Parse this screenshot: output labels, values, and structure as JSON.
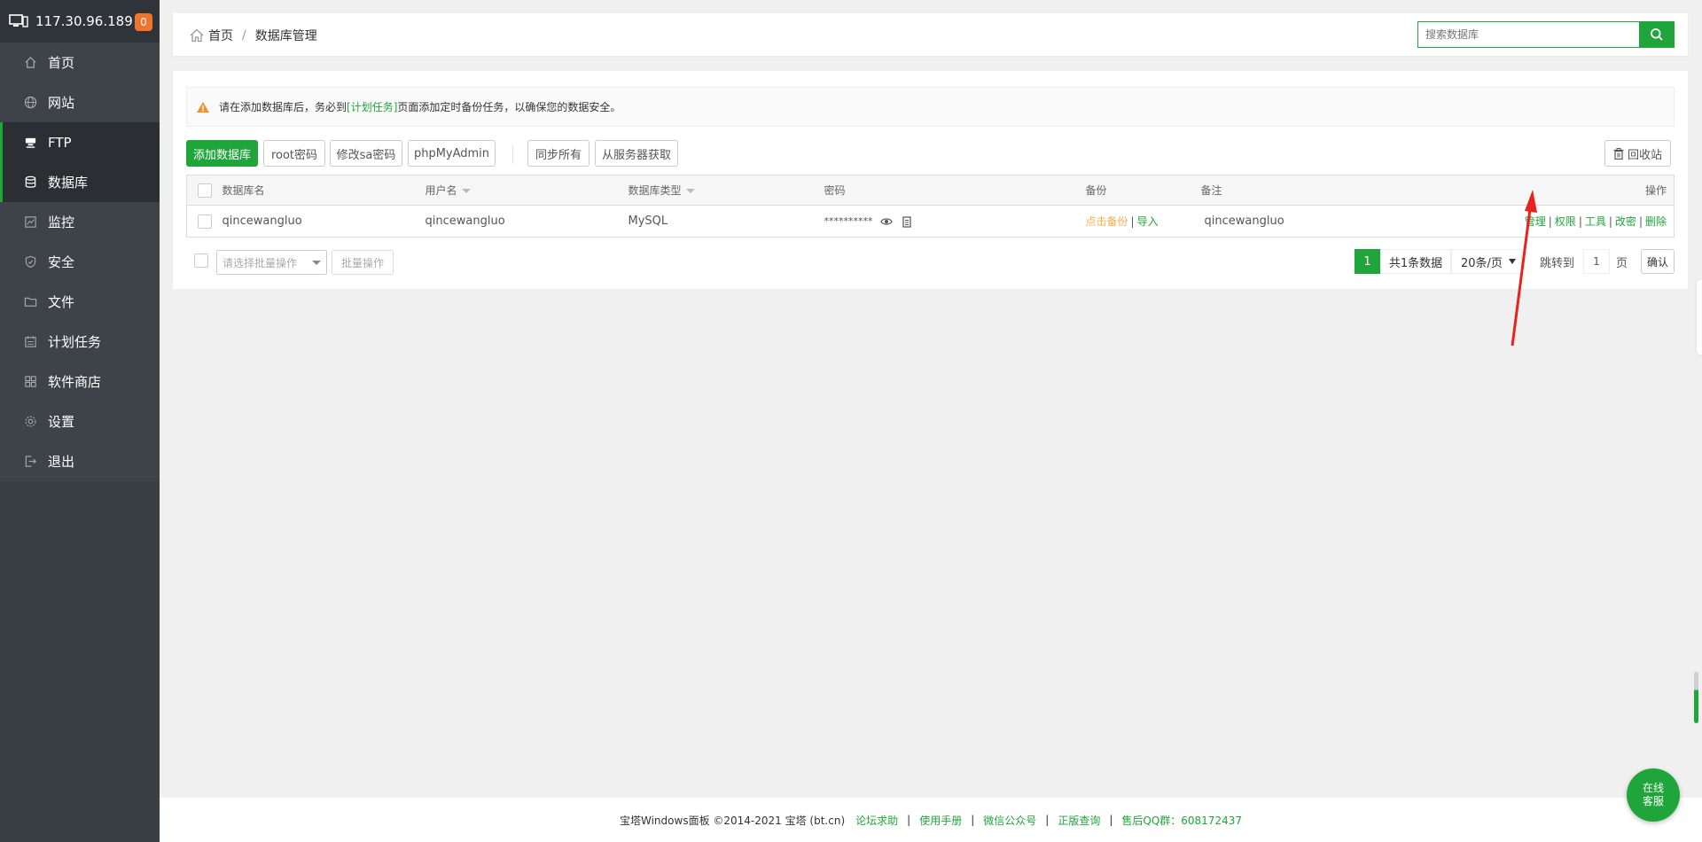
{
  "sidebar": {
    "ip": "117.30.96.189",
    "badge": "0",
    "items": [
      {
        "label": "首页",
        "icon": "home-icon"
      },
      {
        "label": "网站",
        "icon": "globe-icon"
      },
      {
        "label": "FTP",
        "icon": "ftp-icon"
      },
      {
        "label": "数据库",
        "icon": "database-icon"
      },
      {
        "label": "监控",
        "icon": "monitor-icon"
      },
      {
        "label": "安全",
        "icon": "shield-icon"
      },
      {
        "label": "文件",
        "icon": "folder-icon"
      },
      {
        "label": "计划任务",
        "icon": "calendar-icon"
      },
      {
        "label": "软件商店",
        "icon": "grid-icon"
      },
      {
        "label": "设置",
        "icon": "gear-icon"
      },
      {
        "label": "退出",
        "icon": "logout-icon"
      }
    ]
  },
  "breadcrumb": {
    "home": "首页",
    "current": "数据库管理"
  },
  "search": {
    "placeholder": "搜索数据库"
  },
  "notice": {
    "before": "请在添加数据库后，务必到",
    "link": "[计划任务]",
    "after": "页面添加定时备份任务，以确保您的数据安全。"
  },
  "toolbar": {
    "add_db": "添加数据库",
    "root_pwd": "root密码",
    "sa_pwd": "修改sa密码",
    "phpmyadmin": "phpMyAdmin",
    "sync_all": "同步所有",
    "from_server": "从服务器获取",
    "recycle": "回收站"
  },
  "table": {
    "headers": {
      "name": "数据库名",
      "user": "用户名",
      "type": "数据库类型",
      "password": "密码",
      "backup": "备份",
      "note": "备注",
      "ops": "操作"
    },
    "row": {
      "name": "qincewangluo",
      "user": "qincewangluo",
      "type": "MySQL",
      "password": "**********",
      "backup": "点击备份",
      "import": "导入",
      "note": "qincewangluo",
      "ops": [
        "管理",
        "权限",
        "工具",
        "改密",
        "删除"
      ]
    }
  },
  "batch": {
    "placeholder": "请选择批量操作",
    "button": "批量操作"
  },
  "pagination": {
    "current": "1",
    "total": "共1条数据",
    "page_size": "20条/页",
    "jump_label": "跳转到",
    "jump_value": "1",
    "page_unit": "页",
    "confirm": "确认"
  },
  "footer": {
    "copyright": "宝塔Windows面板 ©2014-2021 宝塔 (bt.cn)",
    "links": [
      "论坛求助",
      "使用手册",
      "微信公众号",
      "正版查询",
      "售后QQ群：608172437"
    ]
  },
  "service": {
    "line1": "在线",
    "line2": "客服"
  },
  "colors": {
    "brand": "#20a53a",
    "sidebar": "#3a3f45",
    "badge": "#f0742c",
    "backup_link": "#f0ad4e",
    "arrow": "#e8231d"
  }
}
